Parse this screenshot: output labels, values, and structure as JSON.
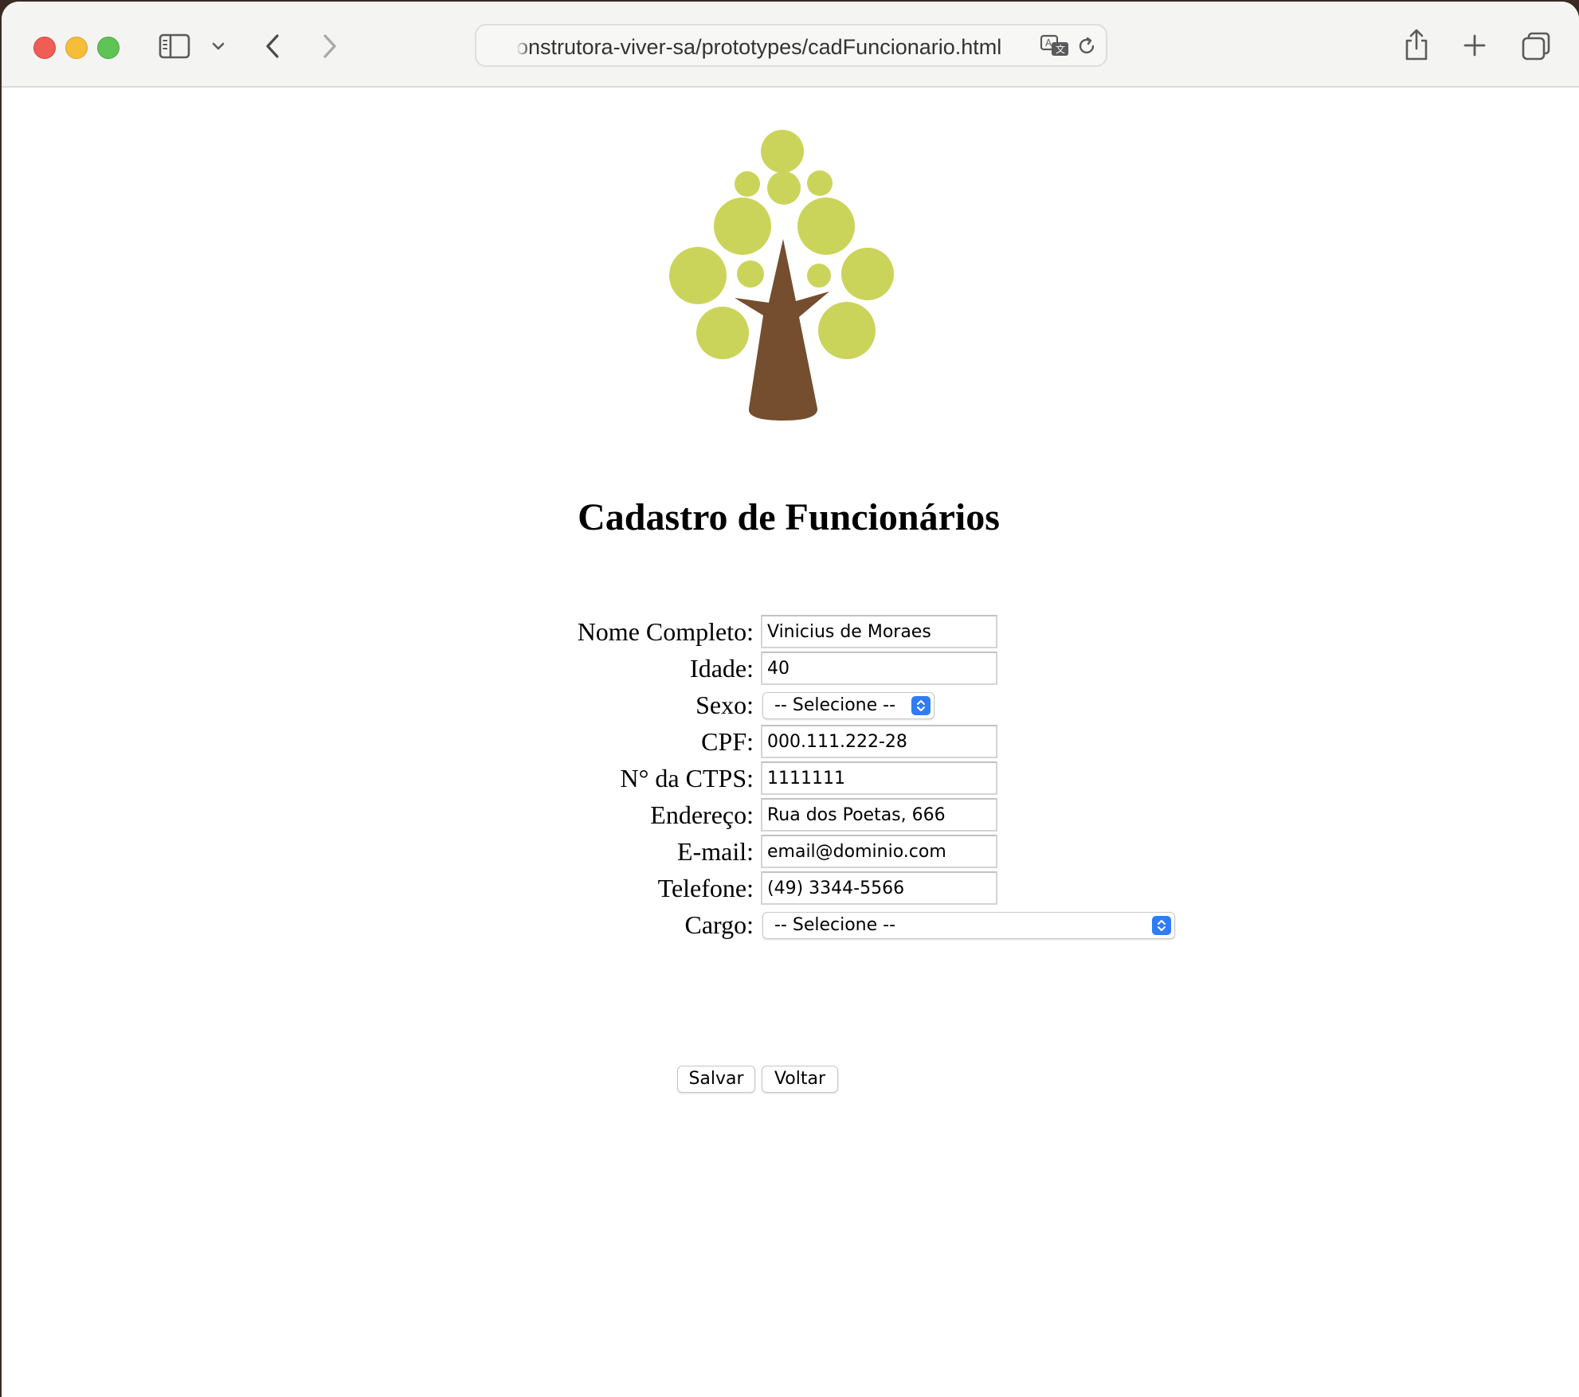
{
  "browser": {
    "url": "onstrutora-viver-sa/prototypes/cadFuncionario.html"
  },
  "page": {
    "title": "Cadastro de Funcionários"
  },
  "form": {
    "fields": [
      {
        "label": "Nome Completo:",
        "value": "Vinicius de Moraes"
      },
      {
        "label": "Idade:",
        "value": "40"
      },
      {
        "label": "Sexo:",
        "value": "-- Selecione --"
      },
      {
        "label": "CPF:",
        "value": "000.111.222-28"
      },
      {
        "label": "N° da CTPS:",
        "value": "1111111"
      },
      {
        "label": "Endereço:",
        "value": "Rua dos Poetas, 666"
      },
      {
        "label": "E-mail:",
        "value": "email@dominio.com"
      },
      {
        "label": "Telefone:",
        "value": "(49) 3344-5566"
      },
      {
        "label": "Cargo:",
        "value": "-- Selecione --"
      }
    ],
    "save_label": "Salvar",
    "back_label": "Voltar"
  },
  "colors": {
    "leaf": "#cbd45a",
    "trunk": "#744e2e",
    "select_accent": "#2f7cf6"
  },
  "icons": [
    "sidebar-icon",
    "chevron-down-icon",
    "back-arrow-icon",
    "forward-arrow-icon",
    "translate-icon",
    "reload-icon",
    "share-icon",
    "new-tab-icon",
    "tabs-overview-icon",
    "tree-logo"
  ]
}
